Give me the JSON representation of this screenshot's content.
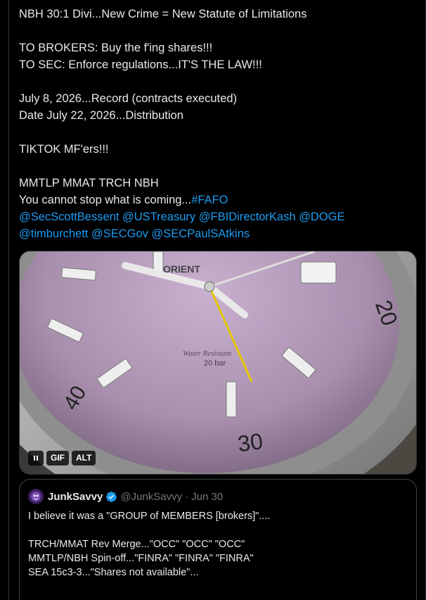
{
  "tweet": {
    "lines": [
      [
        {
          "t": "NBH 30:1 Divi...New Crime = New Statute of Limitations"
        }
      ],
      [],
      [
        {
          "t": "TO BROKERS: Buy the f'ing shares!!!"
        }
      ],
      [
        {
          "t": "TO SEC: Enforce regulations...IT'S THE LAW!!!"
        }
      ],
      [],
      [
        {
          "t": "July 8, 2026...Record (contracts executed)"
        }
      ],
      [
        {
          "t": "Date July 22, 2026...Distribution"
        }
      ],
      [],
      [
        {
          "t": "TIKTOK MF'ers!!!"
        }
      ],
      [],
      [
        {
          "t": "MMTLP MMAT TRCH NBH"
        }
      ],
      [
        {
          "t": "You cannot stop what is coming..."
        },
        {
          "t": "#FAFO",
          "link": true
        }
      ],
      [
        {
          "t": "@SecScottBessent",
          "link": true
        },
        {
          "t": " "
        },
        {
          "t": "@USTreasury",
          "link": true
        },
        {
          "t": " "
        },
        {
          "t": "@FBIDirectorKash",
          "link": true
        },
        {
          "t": " "
        },
        {
          "t": "@DOGE",
          "link": true
        }
      ],
      [
        {
          "t": "@timburchett",
          "link": true
        },
        {
          "t": " "
        },
        {
          "t": "@SECGov",
          "link": true
        },
        {
          "t": " "
        },
        {
          "t": "@SECPaulSAtkins",
          "link": true
        }
      ]
    ]
  },
  "media": {
    "type": "GIF",
    "gif_label": "GIF",
    "alt_label": "ALT",
    "pause_icon": "pause-icon",
    "watch_text": {
      "brand": "ORIENT",
      "water": "Water Resistant",
      "depth": "20 bar",
      "bezel_20": "20",
      "bezel_30": "30",
      "bezel_40": "40"
    }
  },
  "quote": {
    "name": "JunkSavvy",
    "handle": "@JunkSavvy",
    "dot": "·",
    "date": "Jun 30",
    "verified_icon": "verified-badge-icon",
    "lines": [
      "I believe it was a \"GROUP of MEMBERS [brokers]\"....",
      "",
      "TRCH/MMAT Rev Merge...\"OCC\" \"OCC\" \"OCC\"",
      "MMTLP/NBH Spin-off...\"FINRA\" \"FINRA\" \"FINRA\"",
      "SEA 15c3-3...\"Shares not available\"..."
    ]
  },
  "colors": {
    "background": "#000000",
    "text": "#e7e9ea",
    "link": "#1d9bf0",
    "muted": "#71767b",
    "border": "#2f3336"
  }
}
